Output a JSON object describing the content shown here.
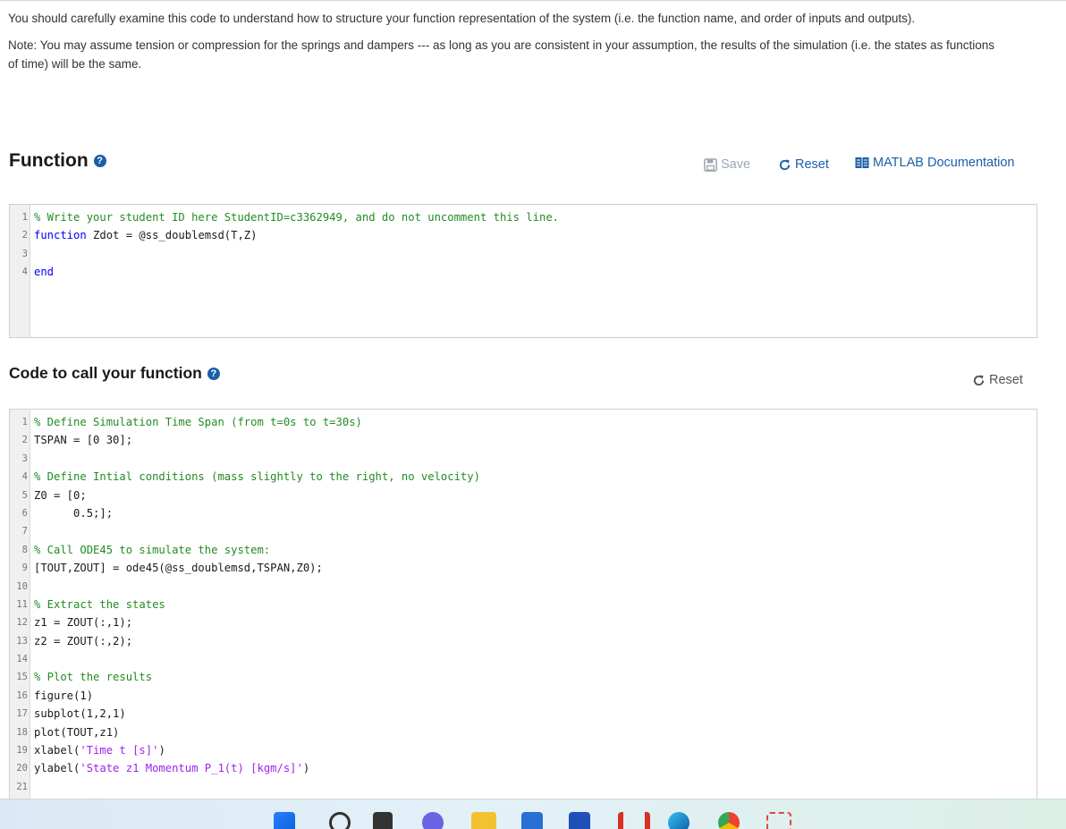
{
  "intro": {
    "para1": "You should carefully examine this code to understand how to structure your function representation of the system (i.e. the function name, and order of inputs and outputs).",
    "para2": "Note: You may assume tension or compression for the springs and dampers --- as long as you are consistent in your assumption, the results of the simulation (i.e. the states as functions of time) will be the same."
  },
  "function_section": {
    "title": "Function",
    "save_label": "Save",
    "reset_label": "Reset",
    "doc_label": "MATLAB Documentation"
  },
  "call_section": {
    "title": "Code to call your function",
    "reset_label": "Reset"
  },
  "function_code": [
    {
      "num": "1",
      "text": "% Write your student ID here StudentID=c3362949, and do not uncomment this line."
    },
    {
      "num": "2",
      "text": "function Zdot = @ss_doublemsd(T,Z)"
    },
    {
      "num": "3",
      "text": ""
    },
    {
      "num": "4",
      "text": "end"
    }
  ],
  "call_code": [
    {
      "num": "1",
      "text": "% Define Simulation Time Span (from t=0s to t=30s)"
    },
    {
      "num": "2",
      "text": "TSPAN = [0 30];"
    },
    {
      "num": "3",
      "text": ""
    },
    {
      "num": "4",
      "text": "% Define Intial conditions (mass slightly to the right, no velocity)"
    },
    {
      "num": "5",
      "text": "Z0 = [0;"
    },
    {
      "num": "6",
      "text": "      0.5;];"
    },
    {
      "num": "7",
      "text": ""
    },
    {
      "num": "8",
      "text": "% Call ODE45 to simulate the system:"
    },
    {
      "num": "9",
      "text": "[TOUT,ZOUT] = ode45(@ss_doublemsd,TSPAN,Z0);"
    },
    {
      "num": "10",
      "text": ""
    },
    {
      "num": "11",
      "text": "% Extract the states"
    },
    {
      "num": "12",
      "text": "z1 = ZOUT(:,1);"
    },
    {
      "num": "13",
      "text": "z2 = ZOUT(:,2);"
    },
    {
      "num": "14",
      "text": ""
    },
    {
      "num": "15",
      "text": "% Plot the results"
    },
    {
      "num": "16",
      "text": "figure(1)"
    },
    {
      "num": "17",
      "text": "subplot(1,2,1)"
    },
    {
      "num": "18",
      "text": "plot(TOUT,z1)"
    },
    {
      "num": "19",
      "text": "xlabel('Time t [s]')"
    },
    {
      "num": "20",
      "text": "ylabel('State z1 Momentum P_1(t) [kgm/s]')"
    },
    {
      "num": "21",
      "text": ""
    }
  ],
  "colors": {
    "comment": "#228b22",
    "keyword": "#0000ff",
    "string": "#a020f0",
    "link": "#1b5fa8",
    "disabled": "#9aa6b2"
  },
  "taskbar": {
    "icons": [
      "windows-start-icon",
      "search-icon",
      "task-view-icon",
      "chat-icon",
      "file-explorer-icon",
      "store-icon",
      "vscode-icon",
      "gmail-icon",
      "edge-icon",
      "chrome-icon",
      "snipping-tool-icon"
    ]
  }
}
